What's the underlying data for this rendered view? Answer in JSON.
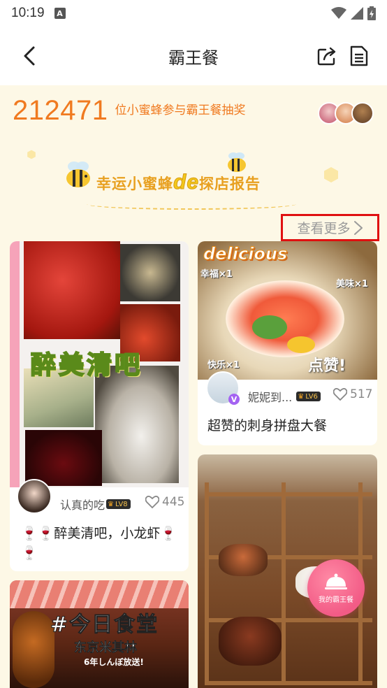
{
  "status": {
    "time": "10:19",
    "a_icon": "A"
  },
  "nav": {
    "title": "霸王餐"
  },
  "participants": {
    "count": "212471",
    "text": "位小蜜蜂参与霸王餐抽奖"
  },
  "report": {
    "prefix": "幸运小蜜蜂",
    "de": "de",
    "suffix": "探店报告"
  },
  "more_label": "查看更多",
  "cards": [
    {
      "overlay": "醉美清吧",
      "author": "认真的吃",
      "level": "LV8",
      "likes": "445",
      "title": "🍷🍷醉美清吧，小龙虾🍷🍷"
    },
    {
      "overlay_top": "delicious",
      "overlay_tags": [
        "幸福×1",
        "美味×1",
        "快乐×1"
      ],
      "overlay_bottom": "点赞!",
      "author": "妮妮到...",
      "level": "LV6",
      "likes": "517",
      "title": "超赞的刺身拼盘大餐"
    },
    {
      "overlay": "#今日食堂",
      "sub1": "东京米其林",
      "sub2": "6年しんぼ放送!"
    },
    {}
  ],
  "fab_label": "我的霸王餐",
  "colors": {
    "accent": "#f07a20",
    "highlight": "#e01010",
    "banner": "#e8a020",
    "fab": "#f25b86"
  }
}
